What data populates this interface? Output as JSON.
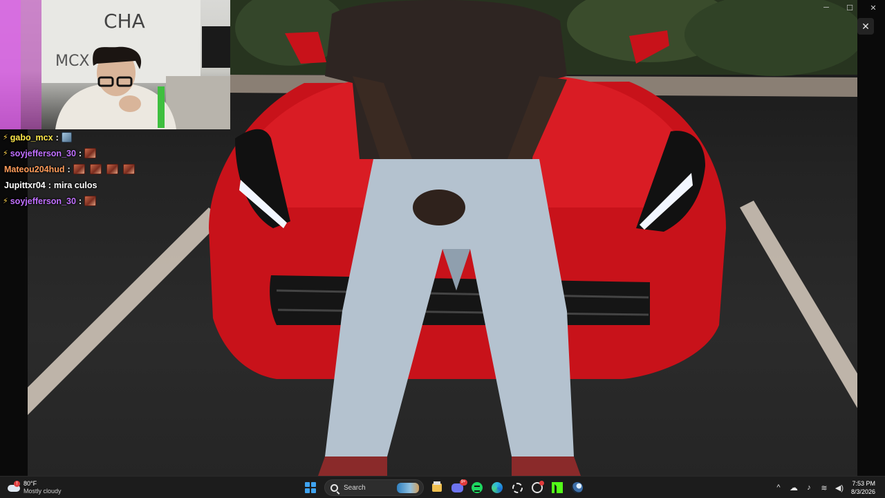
{
  "window": {
    "minimize_glyph": "─",
    "maximize_glyph": "☐",
    "close_glyph": "✕",
    "overlay_close_glyph": "✕"
  },
  "chat": {
    "messages": [
      {
        "user": "gabo_mcx",
        "color": "#ffe94a",
        "badge": true,
        "text": "",
        "emotes": [
          "alt"
        ]
      },
      {
        "user": "soyjefferson_30",
        "color": "#c070ff",
        "badge": true,
        "text": "",
        "emotes": [
          "red"
        ]
      },
      {
        "user": "Mateou204hud",
        "color": "#ff9c5a",
        "badge": false,
        "text": "",
        "emotes": [
          "red",
          "red",
          "red",
          "red"
        ]
      },
      {
        "user": "Jupittxr04",
        "color": "#ffffff",
        "badge": false,
        "text": "mira culos",
        "emotes": []
      },
      {
        "user": "soyjefferson_30",
        "color": "#c070ff",
        "badge": true,
        "text": "",
        "emotes": [
          "red"
        ]
      }
    ],
    "separator": ":"
  },
  "taskbar": {
    "weather": {
      "temp": "80°F",
      "condition": "Mostly cloudy",
      "alert": "!"
    },
    "search_label": "Search",
    "apps": [
      "file-explorer-icon",
      "discord-icon",
      "spotify-icon",
      "edge-icon",
      "settings-tool-icon",
      "chrome-icon",
      "kick-icon",
      "steam-icon"
    ],
    "discord_badge": "9+",
    "tray": {
      "chevron": "^",
      "wifi": "≋",
      "mic": "♪",
      "volume": "◀)"
    },
    "clock": {
      "time": "7:53 PM",
      "date": "8/3/2026"
    }
  },
  "colors": {
    "car_red": "#d0141c",
    "taskbar_bg": "#1c1c1c",
    "accent_blue": "#3fa3f0"
  }
}
